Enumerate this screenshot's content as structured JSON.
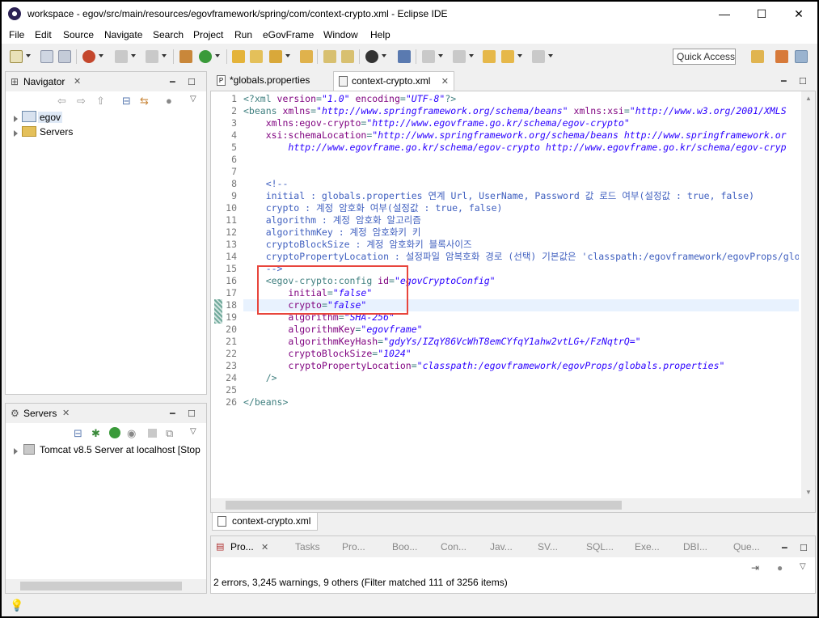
{
  "window": {
    "title": "workspace - egov/src/main/resources/egovframework/spring/com/context-crypto.xml - Eclipse IDE",
    "minimize": "—",
    "maximize": "☐",
    "close": "✕"
  },
  "menu": [
    "File",
    "Edit",
    "Source",
    "Navigate",
    "Search",
    "Project",
    "Run",
    "eGovFrame",
    "Window",
    "Help"
  ],
  "toolbar": {
    "quick_access": "Quick Access"
  },
  "navigator": {
    "tab_label": "Navigator",
    "items": [
      {
        "label": "egov"
      },
      {
        "label": "Servers"
      }
    ]
  },
  "servers": {
    "tab_label": "Servers",
    "items": [
      {
        "label": "Tomcat v8.5 Server at localhost  [Stop"
      }
    ]
  },
  "editor": {
    "tabs": [
      {
        "label": "*globals.properties"
      },
      {
        "label": "context-crypto.xml"
      }
    ],
    "bottom_tab": "context-crypto.xml",
    "current_line": 18,
    "lines": [
      {
        "n": "1",
        "parts": [
          [
            "tag",
            "<?xml "
          ],
          [
            "attr",
            "version"
          ],
          [
            "tag",
            "="
          ],
          [
            "val",
            "\"1.0\""
          ],
          [
            "tag",
            " "
          ],
          [
            "attr",
            "encoding"
          ],
          [
            "tag",
            "="
          ],
          [
            "val",
            "\"UTF-8\""
          ],
          [
            "tag",
            "?>"
          ]
        ]
      },
      {
        "n": "2",
        "parts": [
          [
            "tag",
            "<beans "
          ],
          [
            "attr",
            "xmlns"
          ],
          [
            "tag",
            "="
          ],
          [
            "val",
            "\"http://www.springframework.org/schema/beans\""
          ],
          [
            "tag",
            " "
          ],
          [
            "attr",
            "xmlns:xsi"
          ],
          [
            "tag",
            "="
          ],
          [
            "val",
            "\"http://www.w3.org/2001/XMLS"
          ]
        ]
      },
      {
        "n": "3",
        "parts": [
          [
            "tag",
            "    "
          ],
          [
            "attr",
            "xmlns:egov-crypto"
          ],
          [
            "tag",
            "="
          ],
          [
            "val",
            "\"http://www.egovframe.go.kr/schema/egov-crypto\""
          ]
        ]
      },
      {
        "n": "4",
        "parts": [
          [
            "tag",
            "    "
          ],
          [
            "attr",
            "xsi:schemaLocation"
          ],
          [
            "tag",
            "="
          ],
          [
            "val",
            "\"http://www.springframework.org/schema/beans http://www.springframework.or"
          ]
        ]
      },
      {
        "n": "5",
        "parts": [
          [
            "tag",
            "        "
          ],
          [
            "val",
            "http://www.egovframe.go.kr/schema/egov-crypto http://www.egovframe.go.kr/schema/egov-cryp"
          ]
        ]
      },
      {
        "n": "6",
        "parts": []
      },
      {
        "n": "7",
        "parts": []
      },
      {
        "n": "8",
        "parts": [
          [
            "comm",
            "    <!--"
          ]
        ]
      },
      {
        "n": "9",
        "parts": [
          [
            "comm",
            "    initial : globals.properties 연계 Url, UserName, Password 값 로드 여부(설정값 : true, false)"
          ]
        ]
      },
      {
        "n": "10",
        "parts": [
          [
            "comm",
            "    crypto : 계정 암호화 여부(설정값 : true, false)"
          ]
        ]
      },
      {
        "n": "11",
        "parts": [
          [
            "comm",
            "    algorithm : 계정 암호화 알고리즘"
          ]
        ]
      },
      {
        "n": "12",
        "parts": [
          [
            "comm",
            "    algorithmKey : 계정 암호화키 키"
          ]
        ]
      },
      {
        "n": "13",
        "parts": [
          [
            "comm",
            "    cryptoBlockSize : 계정 암호화키 블록사이즈"
          ]
        ]
      },
      {
        "n": "14",
        "parts": [
          [
            "comm",
            "    cryptoPropertyLocation : 설정파일 암복호화 경로 (선택) 기본값은 'classpath:/egovframework/egovProps/glob"
          ]
        ]
      },
      {
        "n": "15",
        "parts": [
          [
            "comm",
            "    -->"
          ]
        ]
      },
      {
        "n": "16",
        "parts": [
          [
            "tag",
            "    <egov-crypto:config "
          ],
          [
            "attr",
            "id"
          ],
          [
            "tag",
            "="
          ],
          [
            "val",
            "\"egovCryptoConfig\""
          ]
        ]
      },
      {
        "n": "17",
        "parts": [
          [
            "tag",
            "        "
          ],
          [
            "attr",
            "initial"
          ],
          [
            "tag",
            "="
          ],
          [
            "val",
            "\"false\""
          ]
        ]
      },
      {
        "n": "18",
        "parts": [
          [
            "tag",
            "        "
          ],
          [
            "attr",
            "crypto"
          ],
          [
            "tag",
            "="
          ],
          [
            "val",
            "\"false\""
          ]
        ]
      },
      {
        "n": "19",
        "parts": [
          [
            "tag",
            "        "
          ],
          [
            "attr",
            "algorithm"
          ],
          [
            "tag",
            "="
          ],
          [
            "val",
            "\"SHA-256\""
          ]
        ]
      },
      {
        "n": "20",
        "parts": [
          [
            "tag",
            "        "
          ],
          [
            "attr",
            "algorithmKey"
          ],
          [
            "tag",
            "="
          ],
          [
            "val",
            "\"egovframe\""
          ]
        ]
      },
      {
        "n": "21",
        "parts": [
          [
            "tag",
            "        "
          ],
          [
            "attr",
            "algorithmKeyHash"
          ],
          [
            "tag",
            "="
          ],
          [
            "val",
            "\"gdyYs/IZqY86VcWhT8emCYfqY1ahw2vtLG+/FzNqtrQ=\""
          ]
        ]
      },
      {
        "n": "22",
        "parts": [
          [
            "tag",
            "        "
          ],
          [
            "attr",
            "cryptoBlockSize"
          ],
          [
            "tag",
            "="
          ],
          [
            "val",
            "\"1024\""
          ]
        ]
      },
      {
        "n": "23",
        "parts": [
          [
            "tag",
            "        "
          ],
          [
            "attr",
            "cryptoPropertyLocation"
          ],
          [
            "tag",
            "="
          ],
          [
            "val",
            "\"classpath:/egovframework/egovProps/globals.properties\""
          ]
        ]
      },
      {
        "n": "24",
        "parts": [
          [
            "tag",
            "    />"
          ]
        ]
      },
      {
        "n": "25",
        "parts": []
      },
      {
        "n": "26",
        "parts": [
          [
            "tag",
            "</beans>"
          ]
        ]
      }
    ]
  },
  "problems": {
    "tabs": [
      "Pro...",
      "Tasks",
      "Pro...",
      "Boo...",
      "Con...",
      "Jav...",
      "SV...",
      "SQL...",
      "Exe...",
      "DBI...",
      "Que..."
    ],
    "summary": "2 errors, 3,245 warnings, 9 others (Filter matched 111 of 3256 items)"
  },
  "colors": {
    "tag": "#3f7f7f",
    "attr": "#7f007f",
    "value": "#2a00ff",
    "comment": "#3f5fbf",
    "highlight_box": "#e8453c",
    "current_line": "#e8f2fe"
  }
}
